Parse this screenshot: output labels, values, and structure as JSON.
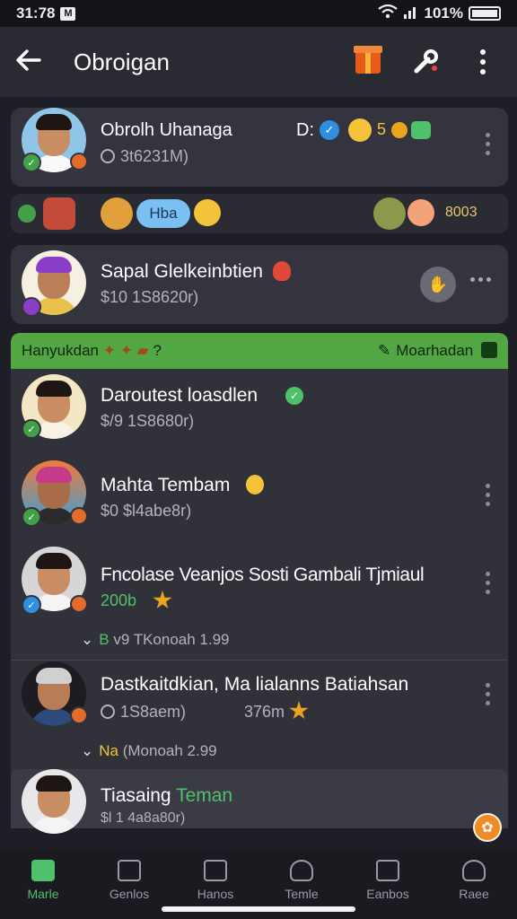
{
  "status": {
    "time": "31:78",
    "carrier_badge": "M",
    "battery_text": "101%"
  },
  "appbar": {
    "title": "Obroigan",
    "icons": [
      "back-arrow-icon",
      "gift-icon",
      "tool-icon",
      "more-icon"
    ]
  },
  "pinned": {
    "name": "Obrolh Uhanaga",
    "sub": "3t6231M)",
    "right_label": "D:",
    "count": "5"
  },
  "strip": {
    "pill": "Hba",
    "right_text": "8003"
  },
  "row2": {
    "name": "Sapal Glelkeinbtien",
    "sub": "$10 1S8620r)"
  },
  "banner": {
    "left": "Hanyukdan",
    "left_extra": "?",
    "right": "Moarhadan"
  },
  "list": [
    {
      "name": "Daroutest loasdlen",
      "sub": "$/9 1S8680r)",
      "extra": "",
      "extra2": ""
    },
    {
      "name": "Mahta Tembam",
      "sub": "$0 $l4abe8r)",
      "extra": "",
      "extra2": ""
    },
    {
      "name": "Fncolase Veanjos Sosti Gambali Tjmiaul",
      "sub": "200b",
      "extra": "B",
      "extra2": "v9 TKonoah 1.99"
    },
    {
      "name": "Dastkaitdkian,  Ma lialanns Batiahsan",
      "sub": "1S8aem)",
      "sub_right": "376m",
      "extra": "Na",
      "extra2": "(Monoah 2.99"
    },
    {
      "name": "Tiasaing",
      "name_accent": "Teman",
      "sub": "$l 1 4a8a80r)",
      "extra": "",
      "extra2": ""
    }
  ],
  "nav": [
    {
      "label": "Marle",
      "icon": "home-icon"
    },
    {
      "label": "Genlos",
      "icon": "store-icon"
    },
    {
      "label": "Hanos",
      "icon": "calendar-icon"
    },
    {
      "label": "Temle",
      "icon": "person-icon"
    },
    {
      "label": "Eanbos",
      "icon": "card-icon"
    },
    {
      "label": "Raee",
      "icon": "profile-icon"
    }
  ],
  "colors": {
    "accent": "#4fc16a",
    "banner": "#52a743",
    "card": "#34343e",
    "background": "#1e1e26"
  }
}
